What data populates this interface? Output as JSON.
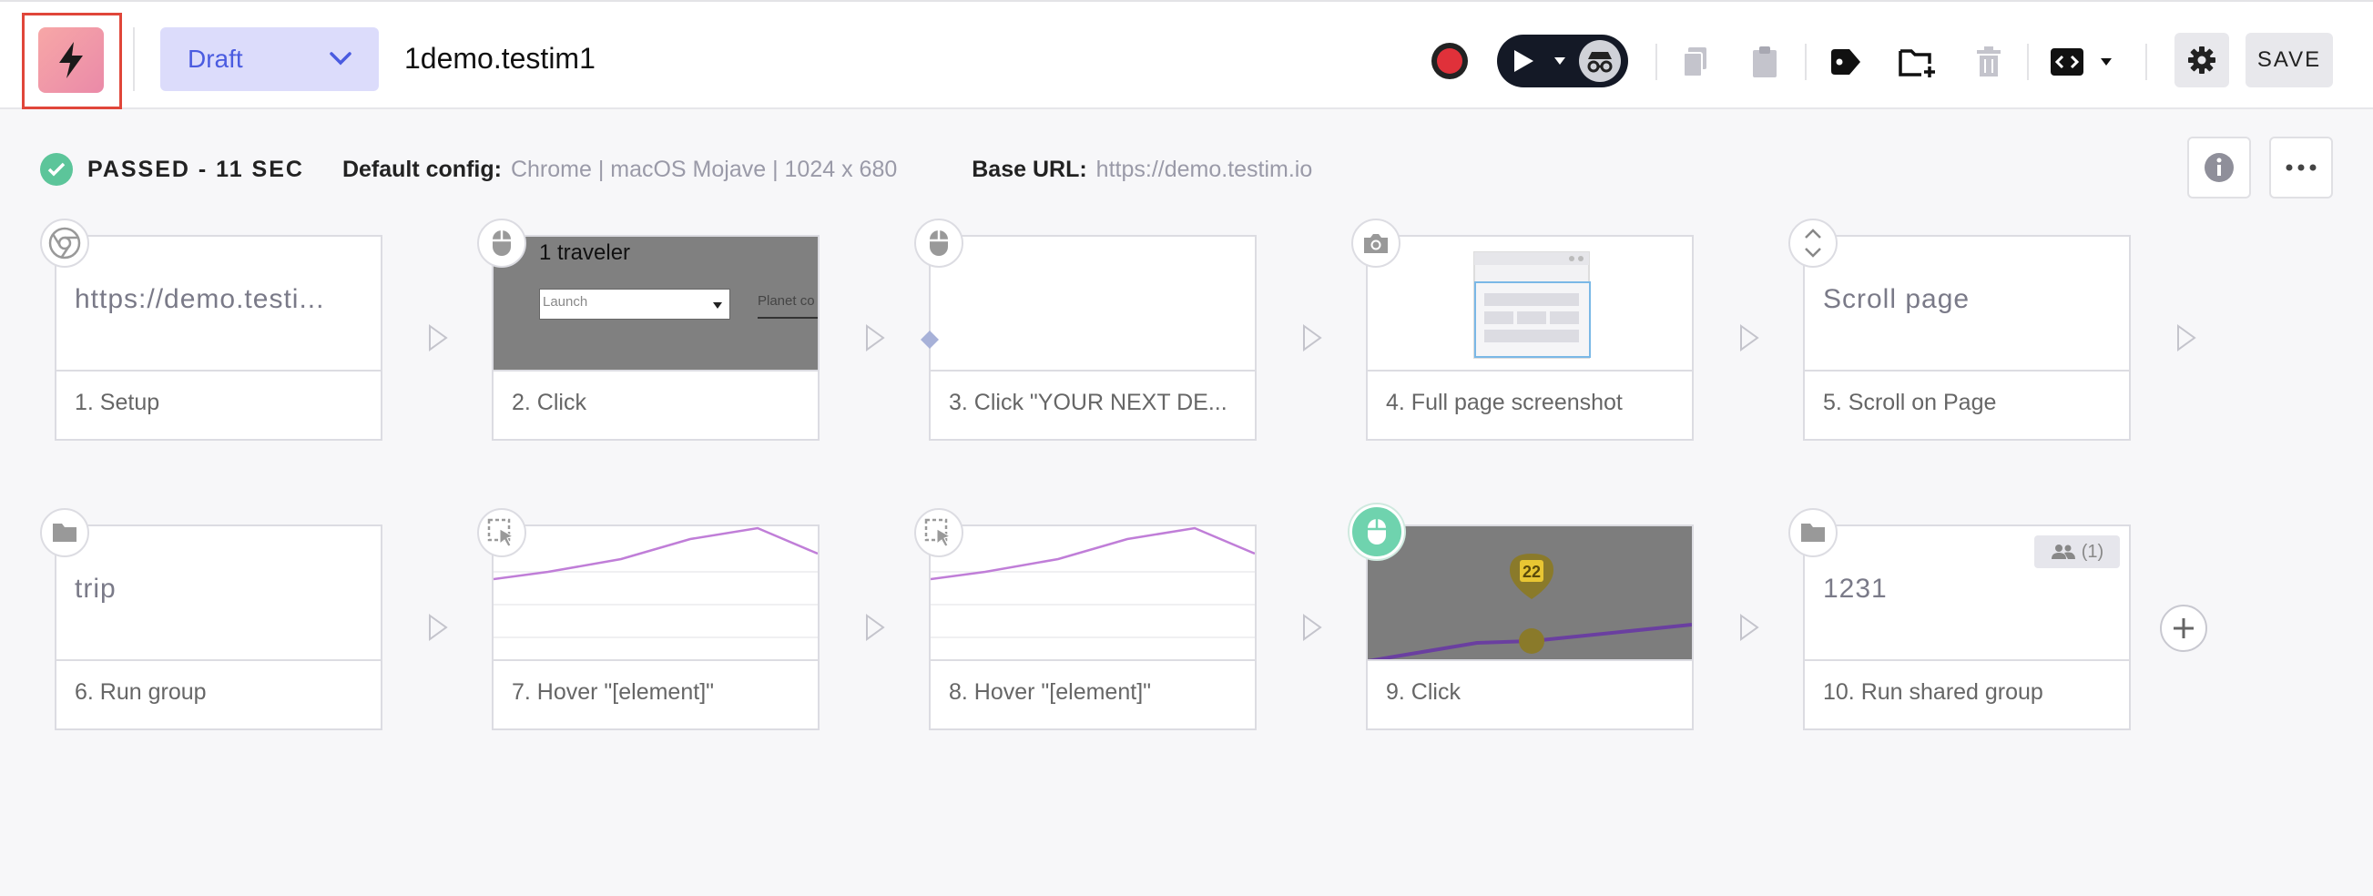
{
  "header": {
    "branch_label": "Draft",
    "test_name": "1demo.testim1",
    "save_label": "SAVE"
  },
  "status": {
    "result": "PASSED - 11 SEC",
    "config_label": "Default config:",
    "config_value": "Chrome | macOS Mojave | 1024 x 680",
    "base_url_label": "Base URL:",
    "base_url_value": "https://demo.testim.io"
  },
  "steps": [
    {
      "label": "1. Setup",
      "preview_text": "https://demo.testi...",
      "icon": "chrome-icon"
    },
    {
      "label": "2. Click",
      "preview_text": "1 traveler",
      "preview_sub": [
        "Launch",
        "Planet co"
      ],
      "icon": "mouse-icon"
    },
    {
      "label": "3. Click \"YOUR NEXT DE...",
      "icon": "mouse-icon"
    },
    {
      "label": "4. Full page screenshot",
      "icon": "camera-icon"
    },
    {
      "label": "5. Scroll on Page",
      "preview_text": "Scroll page",
      "icon": "scroll-icon"
    },
    {
      "label": "6. Run group",
      "preview_text": "trip",
      "icon": "folder-icon"
    },
    {
      "label": "7. Hover \"[element]\"",
      "icon": "hover-icon"
    },
    {
      "label": "8. Hover \"[element]\"",
      "icon": "hover-icon"
    },
    {
      "label": "9. Click",
      "preview_badge": "22",
      "icon": "mouse-icon"
    },
    {
      "label": "10. Run shared group",
      "preview_text": "1231",
      "shared_count": "(1)",
      "icon": "folder-icon"
    }
  ],
  "colors": {
    "accent": "#4a5be0",
    "pass": "#5cc59a",
    "record": "#e0313a",
    "hover_line": "#c07ed8"
  }
}
